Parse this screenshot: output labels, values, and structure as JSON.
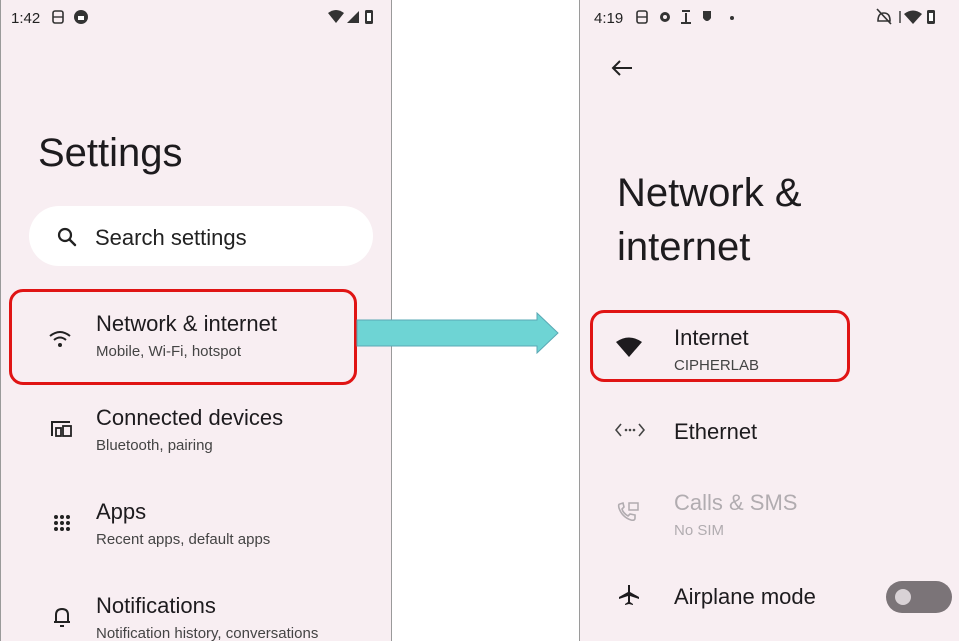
{
  "left_screen": {
    "status_bar": {
      "time": "1:42"
    },
    "title": "Settings",
    "search": {
      "placeholder": "Search settings"
    },
    "items": [
      {
        "title": "Network & internet",
        "subtitle": "Mobile, Wi-Fi, hotspot",
        "icon": "wifi-icon",
        "highlighted": true
      },
      {
        "title": "Connected devices",
        "subtitle": "Bluetooth, pairing",
        "icon": "devices-icon"
      },
      {
        "title": "Apps",
        "subtitle": "Recent apps, default apps",
        "icon": "apps-grid-icon"
      },
      {
        "title": "Notifications",
        "subtitle": "Notification history, conversations",
        "icon": "bell-icon"
      }
    ]
  },
  "right_screen": {
    "status_bar": {
      "time": "4:19"
    },
    "title_line1": "Network &",
    "title_line2": "internet",
    "items": [
      {
        "title": "Internet",
        "subtitle": "CIPHERLAB",
        "icon": "wifi-filled-icon",
        "highlighted": true
      },
      {
        "title": "Ethernet",
        "icon": "ethernet-icon"
      },
      {
        "title": "Calls & SMS",
        "subtitle": "No SIM",
        "icon": "calls-sms-icon",
        "disabled": true
      },
      {
        "title": "Airplane mode",
        "icon": "airplane-icon",
        "toggle": "off"
      }
    ]
  },
  "colors": {
    "highlight": "#e01414",
    "arrow": "#6ed4d4",
    "background": "#f8eef2"
  }
}
